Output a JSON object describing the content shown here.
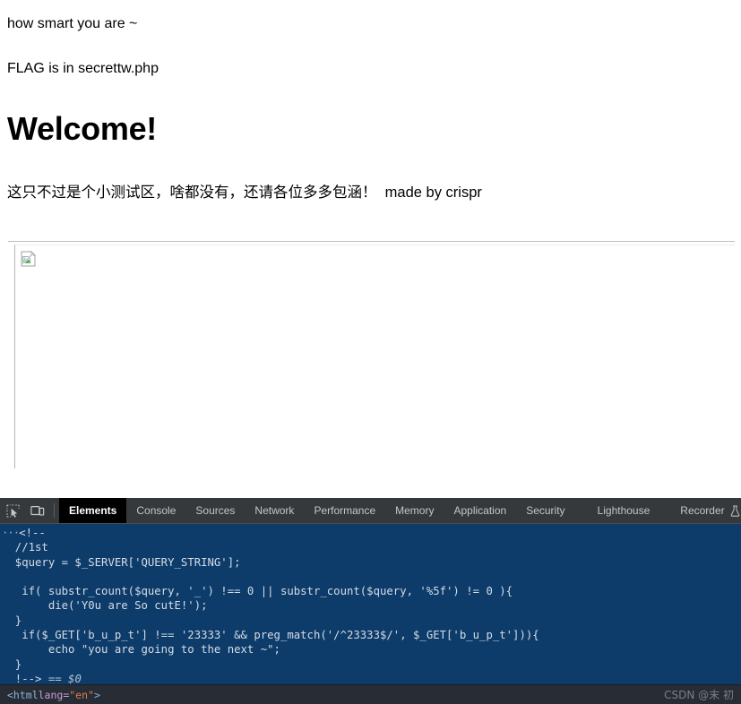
{
  "page": {
    "line1": "how smart you are ~",
    "line2": "FLAG is in secrettw.php",
    "heading": "Welcome!",
    "note_cn": "这只不过是个小测试区，啥都没有，还请各位多多包涵！",
    "note_en": "  made by crispr",
    "broken_image_alt": "broken-image"
  },
  "devtools": {
    "icons": {
      "inspect": "inspect-element-icon",
      "device": "device-toolbar-icon",
      "recorder_flask": "flask-icon"
    },
    "tabs": [
      {
        "label": "Elements",
        "active": true
      },
      {
        "label": "Console",
        "active": false
      },
      {
        "label": "Sources",
        "active": false
      },
      {
        "label": "Network",
        "active": false
      },
      {
        "label": "Performance",
        "active": false
      },
      {
        "label": "Memory",
        "active": false
      },
      {
        "label": "Application",
        "active": false
      },
      {
        "label": "Security",
        "active": false
      },
      {
        "label": "Lighthouse",
        "active": false
      },
      {
        "label": "Recorder",
        "active": false
      }
    ],
    "code_lines": [
      "···<!--",
      "  //1st",
      "  $query = $_SERVER['QUERY_STRING'];",
      "",
      "   if( substr_count($query, '_') !== 0 || substr_count($query, '%5f') != 0 ){",
      "       die('Y0u are So cutE!');",
      "  }",
      "   if($_GET['b_u_p_t'] !== '23333' && preg_match('/^23333$/', $_GET['b_u_p_t'])){",
      "       echo \"you are going to the next ~\";",
      "  }",
      "  !--> "
    ],
    "code_suffix": "== $0",
    "breadcrumb": {
      "open": "<html",
      "attr": " lang=",
      "value": "\"en\"",
      "close": ">"
    },
    "watermark": "CSDN @末 初",
    "colors": {
      "code_bg": "#0d3c6b",
      "toolbar_bg": "#36393c",
      "panel_bg": "#282c34",
      "active_tab_bg": "#000000",
      "code_fg": "#d5dce3"
    }
  }
}
